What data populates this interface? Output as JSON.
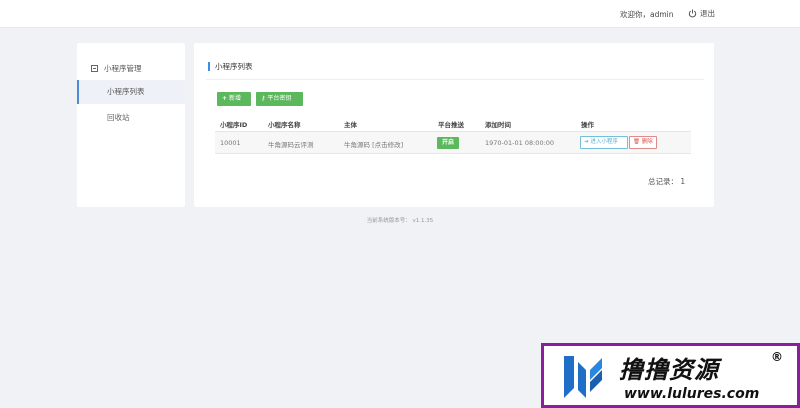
{
  "header": {
    "welcome": "欢迎你，admin",
    "logout": "退出"
  },
  "sidebar": {
    "group": "小程序管理",
    "items": [
      {
        "label": "小程序列表",
        "active": true
      },
      {
        "label": "回收站",
        "active": false
      }
    ]
  },
  "main": {
    "title": "小程序列表",
    "buttons": {
      "add": "新增",
      "platform_key": "平台密钥"
    },
    "table": {
      "headers": [
        "小程序ID",
        "小程序名称",
        "主体",
        "平台推送",
        "添加时间",
        "操作"
      ],
      "rows": [
        {
          "id": "10001",
          "name": "牛角源码云评测",
          "subject": "牛角源码 [点击修改]",
          "push": "开启",
          "added": "1970-01-01 08:00:00",
          "enter": "进入小程序",
          "delete": "删除"
        }
      ]
    },
    "total": "总记录：  1"
  },
  "footer": {
    "version": "当前系统版本号：  v1.1.35"
  },
  "watermark": {
    "title": "撸撸资源",
    "reg": "®",
    "url": "www.lulures.com"
  },
  "colors": {
    "green": "#5cb85c",
    "accent_blue": "#3a8ee6",
    "watermark_border": "#8a1e9c"
  }
}
